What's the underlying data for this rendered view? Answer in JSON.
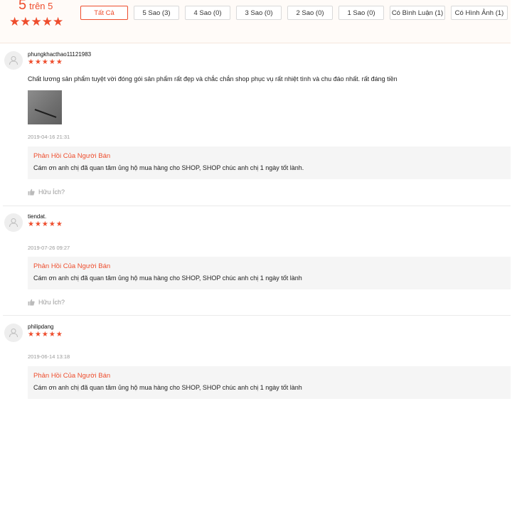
{
  "summary": {
    "score": "5",
    "out_of": "trên 5",
    "stars": "★★★★★",
    "filters": [
      {
        "label": "Tất Cả",
        "active": true
      },
      {
        "label": "5 Sao (3)",
        "active": false
      },
      {
        "label": "4 Sao (0)",
        "active": false
      },
      {
        "label": "3 Sao (0)",
        "active": false
      },
      {
        "label": "2 Sao (0)",
        "active": false
      },
      {
        "label": "1 Sao (0)",
        "active": false
      },
      {
        "label": "Có Bình Luận (1)",
        "active": false
      },
      {
        "label": "Có Hình Ảnh (1)",
        "active": false
      }
    ]
  },
  "reviews": [
    {
      "username": "phungkhacthao11121983",
      "stars": "★★★★★",
      "text": "Chất lương sản phẩm tuyệt vời đóng gói sản phẩm rất đẹp và chắc chắn shop phục vụ rất nhiệt tình và chu đáo nhất. rất đáng tiền",
      "has_photo": true,
      "time": "2019-04-16 21:31",
      "reply_title": "Phản Hồi Của Người Bán",
      "reply_text": "Cám ơn anh chị đã quan tâm ủng hộ mua hàng cho SHOP, SHOP chúc anh chị 1 ngày tốt lành.",
      "helpful": "Hữu Ích?"
    },
    {
      "username": "tiendat.",
      "stars": "★★★★★",
      "time": "2019-07-26 09:27",
      "reply_title": "Phản Hồi Của Người Bán",
      "reply_text": "Cám ơn anh chị đã quan tâm ủng hộ mua hàng cho SHOP, SHOP chúc anh chị 1 ngày tốt lành",
      "helpful": "Hữu Ích?"
    },
    {
      "username": "philipdang",
      "stars": "★★★★★",
      "time": "2019-06-14 13:18",
      "reply_title": "Phản Hồi Của Người Bán",
      "reply_text": "Cám ơn anh chị đã quan tâm ủng hộ mua hàng cho SHOP, SHOP chúc anh chị 1 ngày tốt lành"
    }
  ],
  "colors": {
    "accent": "#ee4d2d",
    "reply_background": "#f5f5f5",
    "summary_background": "#fffbf8"
  },
  "icons": {
    "avatar": "user-avatar-icon",
    "helpful": "thumbs-up-icon",
    "star": "star-icon"
  }
}
